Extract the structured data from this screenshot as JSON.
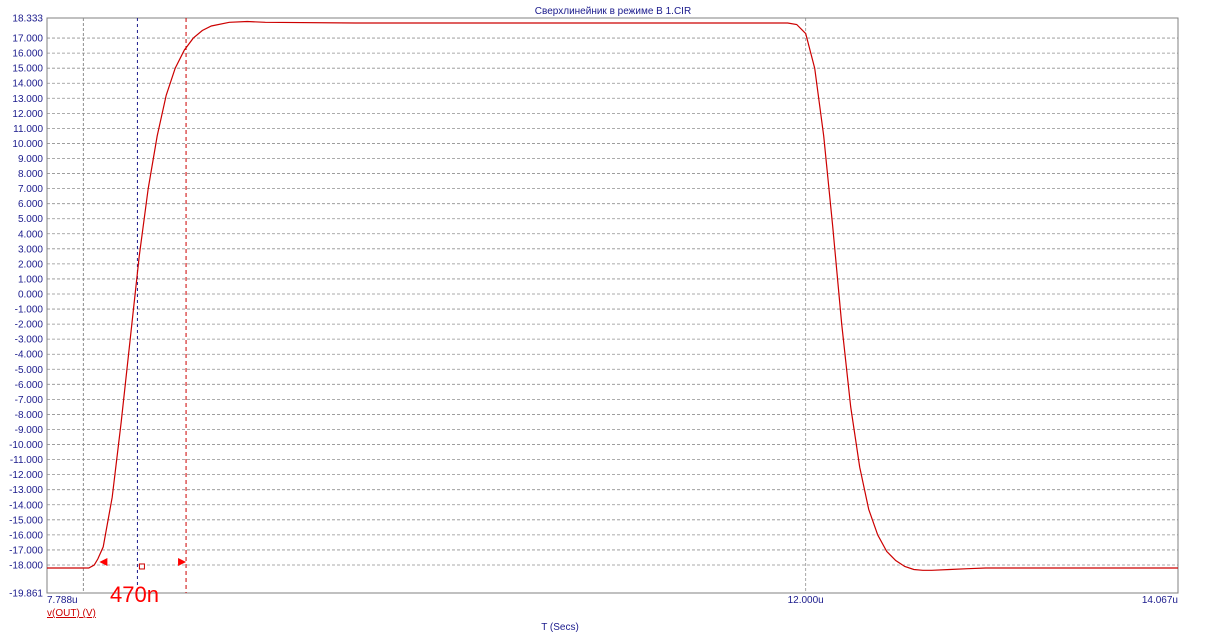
{
  "chart_data": {
    "type": "line",
    "title": "Сверхлинейник в режиме В 1.CIR",
    "xlabel": "T (Secs)",
    "ylabel": "",
    "xlim": [
      7.788,
      14.067
    ],
    "ylim": [
      -19.861,
      18.333
    ],
    "x_tick_labels": [
      "7.788u",
      "12.000u",
      "14.067u"
    ],
    "x_ticks": [
      7.788,
      12.0,
      14.067
    ],
    "y_tick_labels": [
      "18.333",
      "17.000",
      "16.000",
      "15.000",
      "14.000",
      "13.000",
      "12.000",
      "11.000",
      "10.000",
      "9.000",
      "8.000",
      "7.000",
      "6.000",
      "5.000",
      "4.000",
      "3.000",
      "2.000",
      "1.000",
      "0.000",
      "-1.000",
      "-2.000",
      "-3.000",
      "-4.000",
      "-5.000",
      "-6.000",
      "-7.000",
      "-8.000",
      "-9.000",
      "-10.000",
      "-11.000",
      "-12.000",
      "-13.000",
      "-14.000",
      "-15.000",
      "-16.000",
      "-17.000",
      "-18.000",
      "-19.861"
    ],
    "grid": true,
    "legend_position": "bottom-left",
    "series": [
      {
        "name": "v(OUT) (V)",
        "color": "#cc0000",
        "x": [
          7.788,
          8.02,
          8.05,
          8.07,
          8.1,
          8.15,
          8.2,
          8.25,
          8.3,
          8.35,
          8.4,
          8.45,
          8.5,
          8.55,
          8.6,
          8.65,
          8.7,
          8.8,
          8.9,
          9.0,
          9.5,
          11.9,
          11.95,
          12.0,
          12.05,
          12.1,
          12.15,
          12.2,
          12.25,
          12.3,
          12.35,
          12.4,
          12.45,
          12.5,
          12.55,
          12.6,
          12.65,
          12.7,
          12.8,
          12.9,
          13.0,
          14.067
        ],
        "y": [
          -18.2,
          -18.2,
          -18.0,
          -17.6,
          -16.8,
          -13.5,
          -8.5,
          -3.0,
          2.5,
          7.0,
          10.5,
          13.2,
          15.0,
          16.2,
          17.0,
          17.5,
          17.8,
          18.05,
          18.1,
          18.05,
          18.0,
          18.0,
          17.9,
          17.3,
          15.0,
          10.5,
          4.5,
          -2.0,
          -7.5,
          -11.5,
          -14.3,
          -16.0,
          -17.1,
          -17.7,
          -18.1,
          -18.3,
          -18.35,
          -18.35,
          -18.3,
          -18.25,
          -18.2,
          -18.2
        ]
      }
    ],
    "cursors": {
      "color": "#1a1a8c",
      "x": [
        7.99,
        8.29,
        8.56
      ],
      "marker_y": -17.8
    },
    "annotation": "470n"
  }
}
